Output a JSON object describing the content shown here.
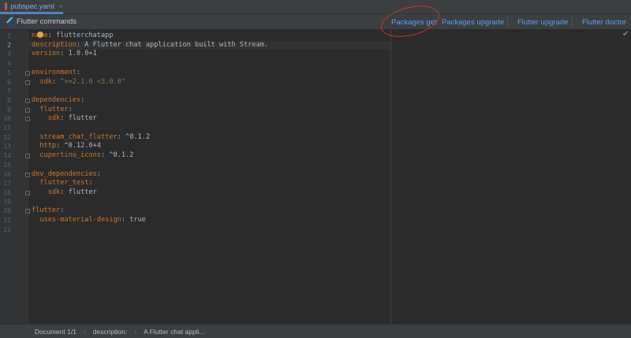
{
  "tab": {
    "label": "pubspec.yaml",
    "close": "×"
  },
  "toolbar": {
    "title": "Flutter commands",
    "commands": [
      "Packages get",
      "Packages upgrade",
      "Flutter upgrade",
      "Flutter doctor"
    ]
  },
  "editor": {
    "current_line": 2,
    "lines": [
      [
        [
          "k",
          "name"
        ],
        [
          "v",
          ": flutterchatapp"
        ]
      ],
      [
        [
          "k",
          "description"
        ],
        [
          "v",
          ": A Flutter chat application built with Stream."
        ]
      ],
      [
        [
          "k",
          "version"
        ],
        [
          "v",
          ": 1.0.0+1"
        ]
      ],
      [],
      [
        [
          "k",
          "environment"
        ],
        [
          "v",
          ":"
        ]
      ],
      [
        [
          "v",
          "  "
        ],
        [
          "k",
          "sdk"
        ],
        [
          "v",
          ": "
        ],
        [
          "s",
          "\">=2.1.0 <3.0.0\""
        ]
      ],
      [],
      [
        [
          "k",
          "dependencies"
        ],
        [
          "v",
          ":"
        ]
      ],
      [
        [
          "v",
          "  "
        ],
        [
          "k",
          "flutter"
        ],
        [
          "v",
          ":"
        ]
      ],
      [
        [
          "v",
          "    "
        ],
        [
          "k",
          "sdk"
        ],
        [
          "v",
          ": flutter"
        ]
      ],
      [],
      [
        [
          "v",
          "  "
        ],
        [
          "k",
          "stream_chat_flutter"
        ],
        [
          "v",
          ": ^0.1.2"
        ]
      ],
      [
        [
          "v",
          "  "
        ],
        [
          "k",
          "http"
        ],
        [
          "v",
          ": ^0.12.0+4"
        ]
      ],
      [
        [
          "v",
          "  "
        ],
        [
          "k",
          "cupertino_icons"
        ],
        [
          "v",
          ": ^0.1.2"
        ]
      ],
      [],
      [
        [
          "k",
          "dev_dependencies"
        ],
        [
          "v",
          ":"
        ]
      ],
      [
        [
          "v",
          "  "
        ],
        [
          "k",
          "flutter_test"
        ],
        [
          "v",
          ":"
        ]
      ],
      [
        [
          "v",
          "    "
        ],
        [
          "k",
          "sdk"
        ],
        [
          "v",
          ": flutter"
        ]
      ],
      [],
      [
        [
          "k",
          "flutter"
        ],
        [
          "v",
          ":"
        ]
      ],
      [
        [
          "v",
          "  "
        ],
        [
          "k",
          "uses-material-design"
        ],
        [
          "v",
          ": true"
        ]
      ],
      []
    ]
  },
  "status": {
    "breadcrumbs": [
      "Document 1/1",
      "description:",
      "A Flutter chat appli..."
    ],
    "separator": "›"
  },
  "colors": {
    "key": "#cc7832",
    "string": "#6a8759",
    "text": "#a9b7c6",
    "link": "#589df6",
    "annotation": "#c0392b"
  },
  "icons": {
    "file": "yaml-file-icon",
    "toolbar": "flutter-logo-icon",
    "status": "check-icon",
    "bulb": "intention-bulb-icon"
  }
}
